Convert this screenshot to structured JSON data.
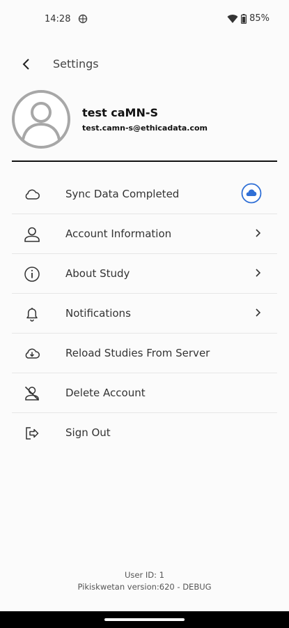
{
  "status_bar": {
    "time": "14:28",
    "battery": "85%"
  },
  "app_bar": {
    "title": "Settings"
  },
  "profile": {
    "name": "test caMN-S",
    "email": "test.camn-s@ethicadata.com"
  },
  "menu": {
    "items": [
      {
        "label": "Sync Data Completed",
        "icon": "cloud-icon"
      },
      {
        "label": "Account Information",
        "icon": "person-icon"
      },
      {
        "label": "About Study",
        "icon": "info-icon"
      },
      {
        "label": "Notifications",
        "icon": "bell-icon"
      },
      {
        "label": "Reload Studies From Server",
        "icon": "cloud-download-icon"
      },
      {
        "label": "Delete Account",
        "icon": "person-off-icon"
      },
      {
        "label": "Sign Out",
        "icon": "sign-out-icon"
      }
    ]
  },
  "footer": {
    "user_id": "User ID: 1",
    "version": "Pikiskwetan version:620 - DEBUG"
  },
  "colors": {
    "accent": "#2f6fd6",
    "divider": "#111111"
  }
}
